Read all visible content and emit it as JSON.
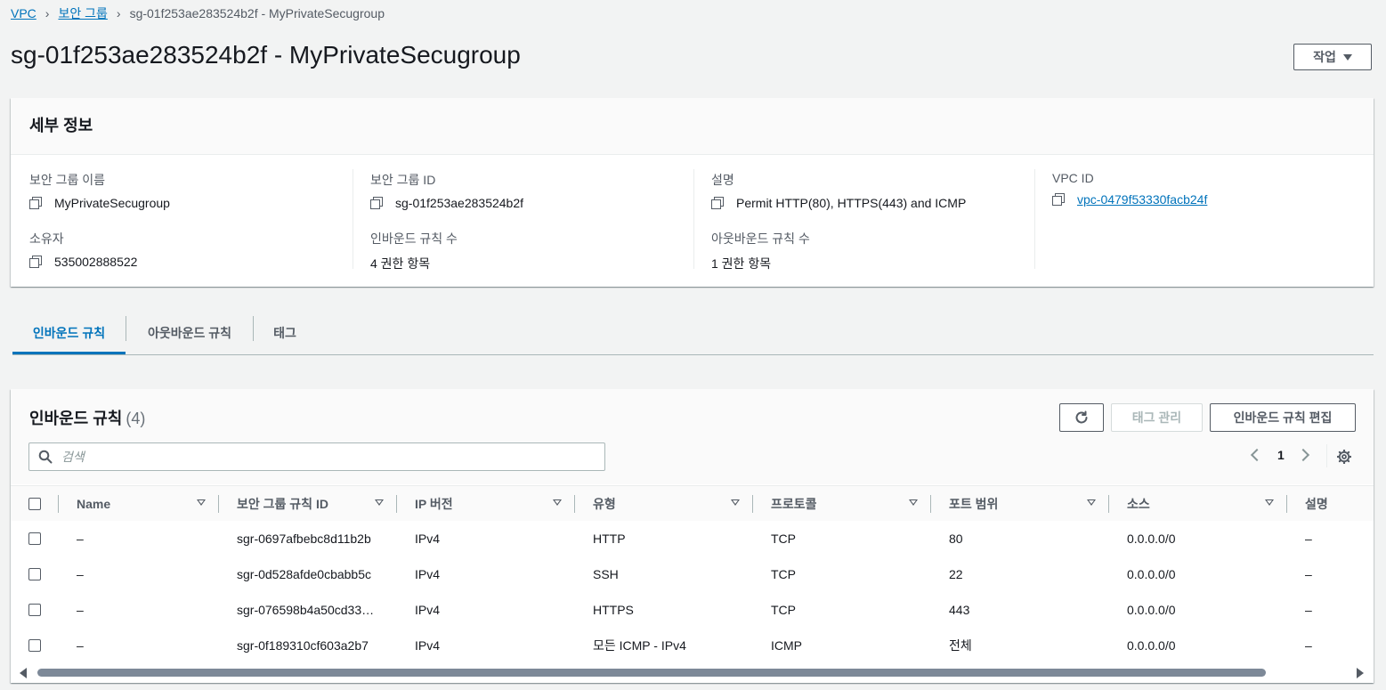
{
  "breadcrumb": {
    "items": [
      {
        "label": "VPC"
      },
      {
        "label": "보안 그룹"
      },
      {
        "label": "sg-01f253ae283524b2f - MyPrivateSecugroup"
      }
    ]
  },
  "page": {
    "title": "sg-01f253ae283524b2f - MyPrivateSecugroup",
    "actions_label": "작업"
  },
  "details": {
    "title": "세부 정보",
    "fields": {
      "sg_name": {
        "label": "보안 그룹 이름",
        "value": "MyPrivateSecugroup"
      },
      "sg_id": {
        "label": "보안 그룹 ID",
        "value": "sg-01f253ae283524b2f"
      },
      "description": {
        "label": "설명",
        "value": "Permit HTTP(80), HTTPS(443) and ICMP"
      },
      "vpc_id": {
        "label": "VPC ID",
        "value": "vpc-0479f53330facb24f"
      },
      "owner": {
        "label": "소유자",
        "value": "535002888522"
      },
      "inbound_count": {
        "label": "인바운드 규칙 수",
        "value": "4 권한 항목"
      },
      "outbound_count": {
        "label": "아웃바운드 규칙 수",
        "value": "1 권한 항목"
      }
    }
  },
  "tabs": [
    {
      "label": "인바운드 규칙",
      "active": true
    },
    {
      "label": "아웃바운드 규칙",
      "active": false
    },
    {
      "label": "태그",
      "active": false
    }
  ],
  "rules": {
    "title": "인바운드 규칙",
    "count": "(4)",
    "buttons": {
      "refresh_icon": "refresh-icon",
      "manage_tags": "태그 관리",
      "edit_rules": "인바운드 규칙 편집"
    },
    "search": {
      "placeholder": "검색",
      "value": ""
    },
    "pagination": {
      "page": "1"
    },
    "columns": [
      "Name",
      "보안 그룹 규칙 ID",
      "IP 버전",
      "유형",
      "프로토콜",
      "포트 범위",
      "소스",
      "설명"
    ],
    "rows": [
      {
        "name": "–",
        "rule_id": "sgr-0697afbebc8d11b2b",
        "ip_version": "IPv4",
        "type": "HTTP",
        "protocol": "TCP",
        "port_range": "80",
        "source": "0.0.0.0/0",
        "description": "–"
      },
      {
        "name": "–",
        "rule_id": "sgr-0d528afde0cbabb5c",
        "ip_version": "IPv4",
        "type": "SSH",
        "protocol": "TCP",
        "port_range": "22",
        "source": "0.0.0.0/0",
        "description": "–"
      },
      {
        "name": "–",
        "rule_id": "sgr-076598b4a50cd33…",
        "ip_version": "IPv4",
        "type": "HTTPS",
        "protocol": "TCP",
        "port_range": "443",
        "source": "0.0.0.0/0",
        "description": "–"
      },
      {
        "name": "–",
        "rule_id": "sgr-0f189310cf603a2b7",
        "ip_version": "IPv4",
        "type": "모든 ICMP - IPv4",
        "protocol": "ICMP",
        "port_range": "전체",
        "source": "0.0.0.0/0",
        "description": "–"
      }
    ]
  },
  "colors": {
    "link": "#0073bb",
    "background": "#f2f3f3",
    "text": "#16191f",
    "muted": "#545b64"
  }
}
